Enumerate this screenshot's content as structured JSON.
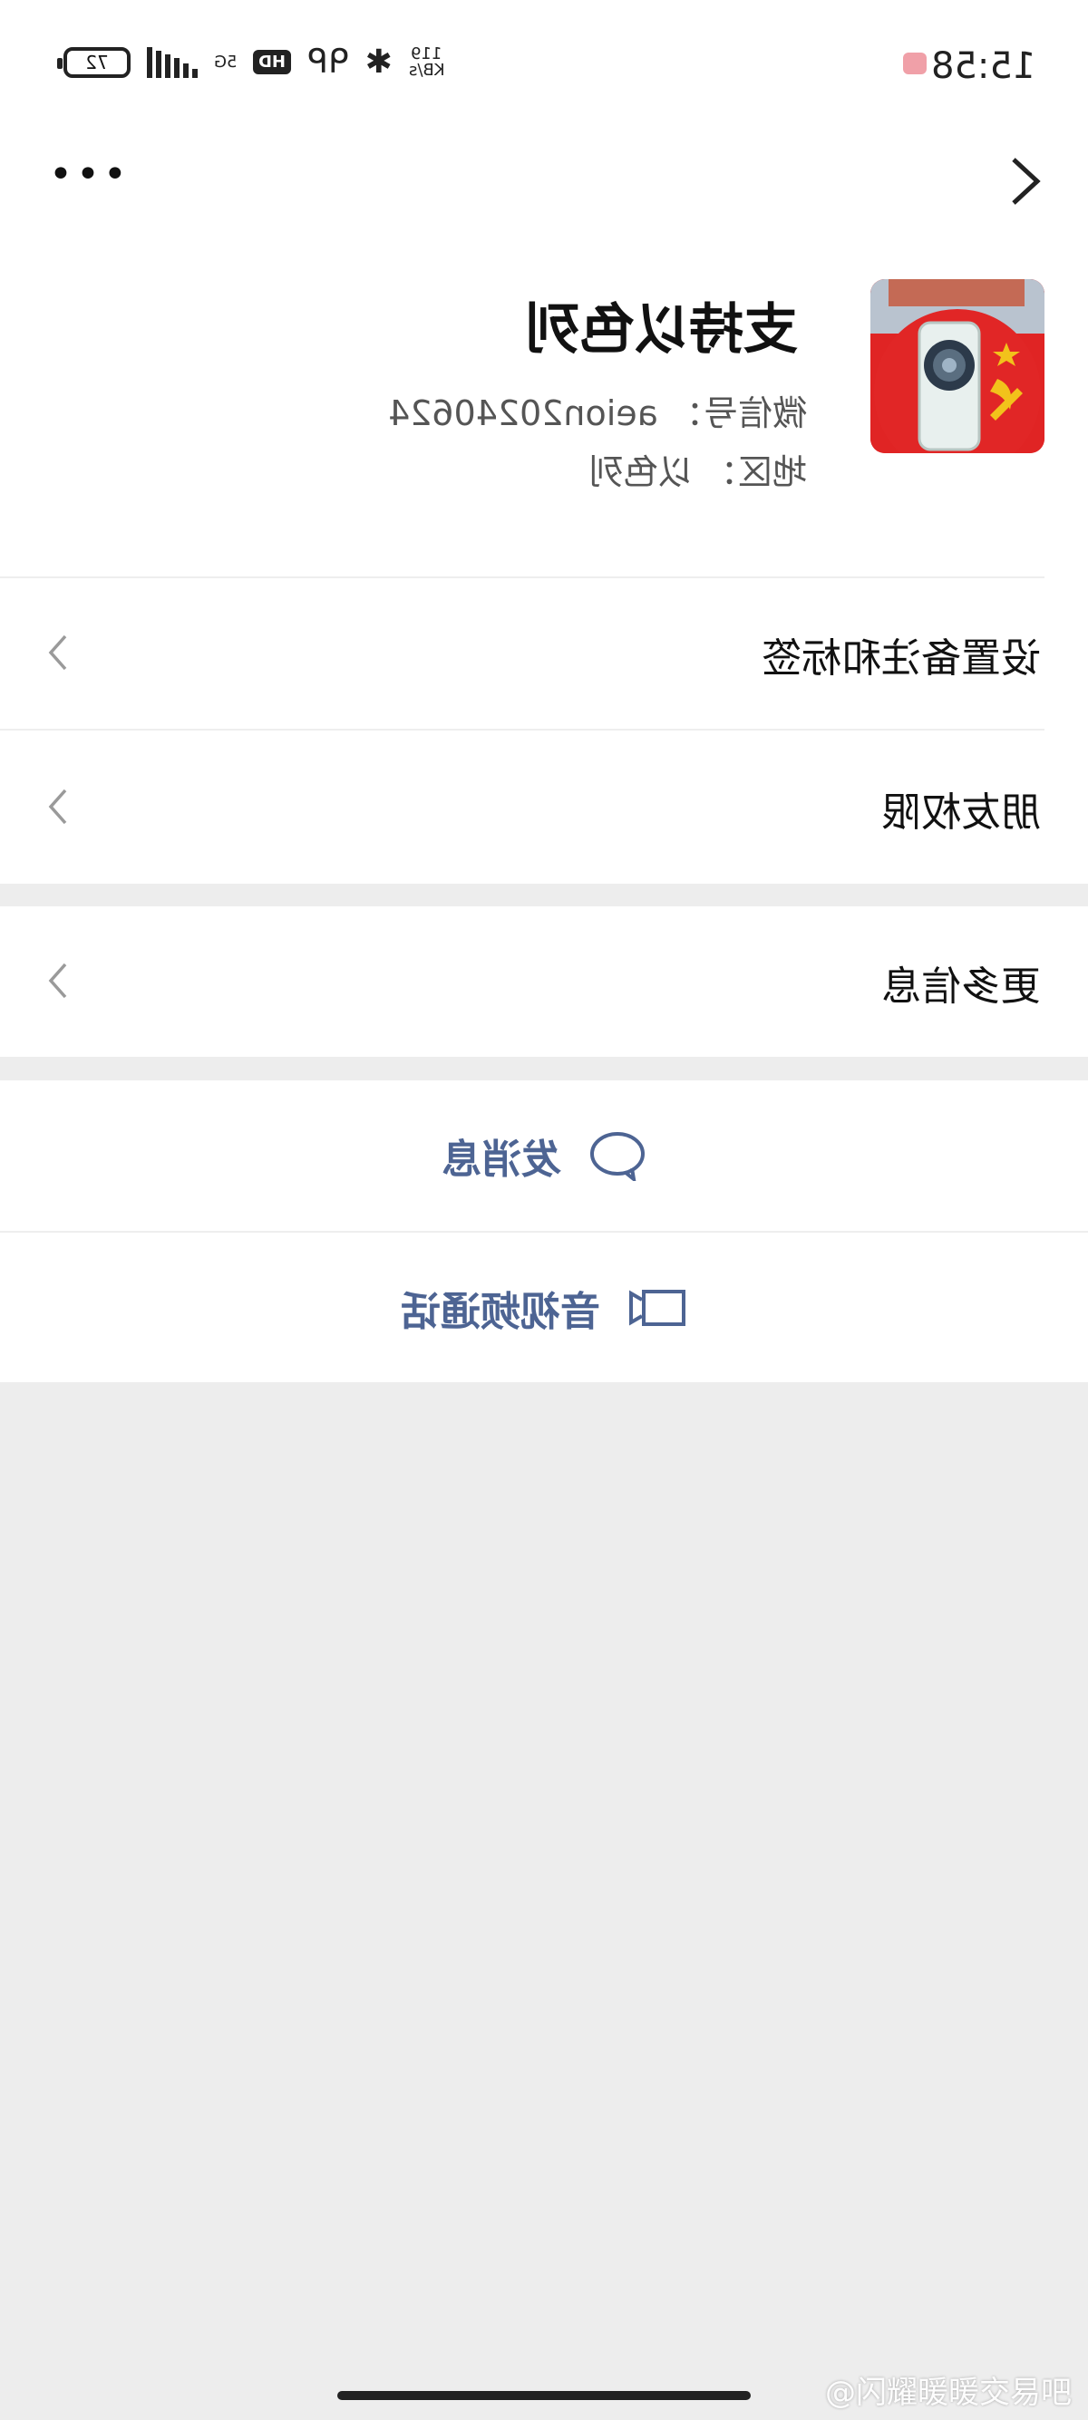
{
  "status_bar": {
    "time": "15:58",
    "battery": "72",
    "network": "5G",
    "hd": "HD",
    "speed_value": "119",
    "speed_unit": "KB/s"
  },
  "profile": {
    "name": "支持以色列",
    "wechat_id_label": "微信号：",
    "wechat_id": "aeion20240624",
    "region_label": "地区：",
    "region": "以色列"
  },
  "rows": {
    "remark": "设置备注和标签",
    "permissions": "朋友权限",
    "more_info": "更多信息"
  },
  "actions": {
    "message": "发消息",
    "video_call": "音视频通话"
  },
  "watermark": "@闪耀暖暖交易吧"
}
